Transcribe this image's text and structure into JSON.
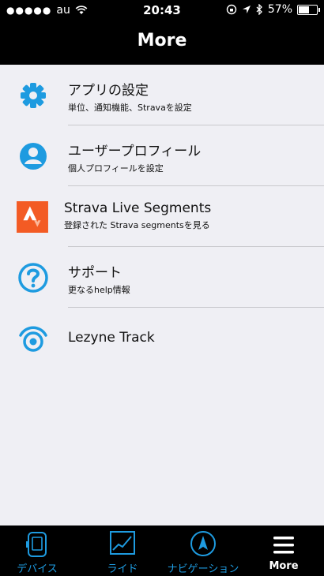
{
  "status_bar": {
    "carrier": "au",
    "time": "20:43",
    "battery": "57%",
    "battery_level": 0.57
  },
  "nav": {
    "title": "More"
  },
  "menu": [
    {
      "title": "アプリの設定",
      "subtitle": "単位、通知機能、Stravaを設定",
      "icon": "gear-icon"
    },
    {
      "title": "ユーザープロフィール",
      "subtitle": "個人プロフィールを設定",
      "icon": "user-icon"
    },
    {
      "title": "Strava Live Segments",
      "subtitle": "登録された Strava segmentsを見る",
      "icon": "strava-icon"
    },
    {
      "title": "サポート",
      "subtitle": "更なるhelp情報",
      "icon": "question-icon"
    },
    {
      "title": "Lezyne Track",
      "icon": "track-icon"
    }
  ],
  "tabs": [
    {
      "label": "デバイス",
      "icon": "device-icon"
    },
    {
      "label": "ライド",
      "icon": "chart-icon"
    },
    {
      "label": "ナビゲーション",
      "icon": "navigation-icon"
    },
    {
      "label": "More",
      "icon": "menu-icon"
    }
  ],
  "colors": {
    "accent": "#1e9be0",
    "strava": "#f35b24",
    "background": "#efeff4"
  }
}
